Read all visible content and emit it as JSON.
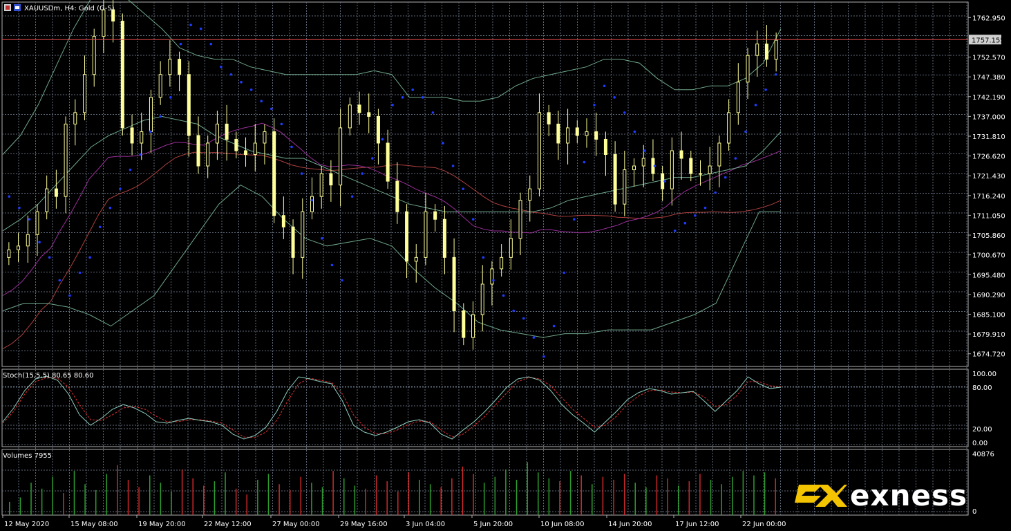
{
  "header": {
    "symbol_title": "XAUUSDm, H4:  Gold (G-S)"
  },
  "indicators": {
    "stoch_label": "Stoch(15,5,5) 80.65 80.60",
    "volumes_label": "Volumes 7955"
  },
  "branding": {
    "name": "exness",
    "logo_color": "#f5c400"
  },
  "colors": {
    "background": "#000000",
    "grid": "#5f6a7a",
    "frame": "#b0b0b0",
    "candle": "#ffff99",
    "bollinger": "#6fa88c",
    "ma_fast": "#9b2f9b",
    "ma_slow": "#b04040",
    "psar": "#1f3cff",
    "current_price_line": "#e04a4a",
    "stoch_main": "#8fcfc0",
    "stoch_signal": "#e03030",
    "volume_up": "#2e9e2e",
    "volume_down": "#d02a2a"
  },
  "chart_data": [
    {
      "type": "candlestick",
      "title": "XAUUSDm, H4:  Gold (G-S)",
      "y_ticks": [
        "1762.950",
        "1757.155",
        "1752.570",
        "1747.380",
        "1742.190",
        "1737.000",
        "1731.810",
        "1726.620",
        "1721.430",
        "1716.240",
        "1711.050",
        "1705.860",
        "1700.670",
        "1695.480",
        "1690.290",
        "1685.100",
        "1679.910",
        "1674.720"
      ],
      "current_price": 1757.155,
      "ylim": [
        1671.4,
        1767.0
      ],
      "x_ticks": [
        "12 May 2020",
        "15 May 08:00",
        "19 May 20:00",
        "22 May 12:00",
        "27 May 00:00",
        "29 May 16:00",
        "3 Jun 04:00",
        "5 Jun 20:00",
        "10 Jun 08:00",
        "14 Jun 20:00",
        "17 Jun 12:00",
        "22 Jun 00:00"
      ],
      "close_series": [
        1702,
        1703,
        1706,
        1712,
        1718,
        1716,
        1735,
        1738,
        1748,
        1758,
        1765,
        1762,
        1734,
        1730,
        1733,
        1742,
        1748,
        1752,
        1748,
        1732,
        1724,
        1730,
        1735,
        1731,
        1728,
        1727,
        1730,
        1733,
        1711,
        1708,
        1700,
        1712,
        1716,
        1722,
        1719,
        1734,
        1740,
        1738,
        1737,
        1730,
        1720,
        1712,
        1699,
        1700,
        1712,
        1710,
        1700,
        1686,
        1679,
        1685,
        1693,
        1697,
        1700,
        1705,
        1715,
        1718,
        1738,
        1735,
        1730,
        1734,
        1732,
        1733,
        1731,
        1727,
        1714,
        1723,
        1724,
        1726,
        1722,
        1718,
        1728,
        1726,
        1722,
        1722,
        1724,
        1730,
        1738,
        1746,
        1753,
        1756,
        1752,
        1757
      ],
      "bollinger_upper_series": [
        1727,
        1732,
        1740,
        1750,
        1760,
        1768,
        1770,
        1768,
        1764,
        1760,
        1755,
        1753,
        1752,
        1752,
        1750,
        1749,
        1748,
        1748,
        1748,
        1748,
        1748,
        1749,
        1748,
        1742,
        1742,
        1742,
        1741,
        1741,
        1742,
        1745,
        1747,
        1748,
        1749,
        1750,
        1752,
        1752,
        1751,
        1747,
        1744,
        1744,
        1745,
        1745,
        1747,
        1751,
        1760
      ],
      "bollinger_mid_series": [
        1707,
        1710,
        1714,
        1719,
        1724,
        1729,
        1732,
        1734,
        1736,
        1737,
        1736,
        1735,
        1732,
        1730,
        1728,
        1727,
        1726,
        1726,
        1724,
        1722,
        1720,
        1718,
        1716,
        1714,
        1713,
        1712,
        1712,
        1712,
        1712,
        1712,
        1712,
        1713,
        1715,
        1716,
        1717,
        1718,
        1719,
        1720,
        1721,
        1721,
        1722,
        1723,
        1724,
        1728,
        1733
      ],
      "bollinger_lower_series": [
        1686,
        1688,
        1688,
        1687,
        1685,
        1682,
        1686,
        1690,
        1698,
        1706,
        1714,
        1719,
        1716,
        1710,
        1705,
        1703,
        1704,
        1705,
        1703,
        1697,
        1692,
        1688,
        1683,
        1681,
        1680,
        1679,
        1680,
        1680,
        1681,
        1681,
        1681,
        1683,
        1685,
        1688,
        1700,
        1712,
        1712
      ],
      "psar_series": [
        1716,
        1713,
        1710,
        1704,
        1700,
        1694,
        1690,
        1696,
        1700,
        1708,
        1713,
        1718,
        1723,
        1727,
        1733,
        1737,
        1742,
        1756,
        1761,
        1760,
        1756,
        1750,
        1748,
        1746,
        1744,
        1741,
        1739,
        1735,
        1729,
        1722,
        1715,
        1705,
        1698,
        1694,
        1716,
        1722,
        1726,
        1731,
        1740,
        1742,
        1744,
        1742,
        1738,
        1730,
        1724,
        1718,
        1710,
        1700,
        1694,
        1690,
        1686,
        1684,
        1679,
        1674,
        1682,
        1696,
        1710,
        1725,
        1740,
        1745,
        1742,
        1738,
        1733,
        1728,
        1724,
        1720,
        1707,
        1709,
        1711,
        1713,
        1717,
        1721,
        1726,
        1733,
        1740,
        1744,
        1748
      ]
    },
    {
      "type": "line",
      "name": "Stoch(15,5,5) 80.65 80.60",
      "y_ticks": [
        "100.00",
        "80.00",
        "20.00",
        "0.00"
      ],
      "ylim": [
        0,
        100
      ],
      "main": [
        30,
        50,
        75,
        92,
        96,
        90,
        70,
        40,
        25,
        35,
        48,
        55,
        50,
        42,
        30,
        28,
        32,
        35,
        32,
        30,
        25,
        12,
        5,
        10,
        22,
        45,
        75,
        95,
        92,
        88,
        85,
        60,
        25,
        15,
        10,
        15,
        22,
        30,
        33,
        28,
        12,
        5,
        18,
        30,
        45,
        62,
        80,
        92,
        95,
        90,
        75,
        55,
        40,
        28,
        15,
        30,
        45,
        62,
        72,
        78,
        75,
        70,
        72,
        74,
        60,
        45,
        60,
        75,
        95,
        85,
        78,
        80
      ],
      "signal": [
        28,
        45,
        70,
        88,
        94,
        93,
        80,
        55,
        33,
        32,
        40,
        50,
        52,
        48,
        38,
        30,
        30,
        33,
        33,
        31,
        28,
        18,
        8,
        7,
        15,
        32,
        60,
        85,
        93,
        90,
        87,
        70,
        40,
        22,
        13,
        13,
        18,
        26,
        31,
        30,
        18,
        8,
        12,
        24,
        38,
        55,
        72,
        88,
        94,
        92,
        82,
        65,
        48,
        35,
        22,
        25,
        38,
        55,
        67,
        75,
        76,
        73,
        72,
        73,
        66,
        52,
        55,
        68,
        88,
        88,
        82,
        81
      ]
    },
    {
      "type": "bar",
      "name": "Volumes 7955",
      "y_ticks": [
        "40876",
        "0"
      ],
      "ylim": [
        0,
        40876
      ],
      "values": [
        9000,
        12000,
        22000,
        18000,
        26000,
        15000,
        30000,
        21000,
        17000,
        28000,
        34000,
        24000,
        19000,
        27000,
        22000,
        16000,
        31000,
        25000,
        20000,
        23000,
        29000,
        18000,
        14000,
        24000,
        28000,
        21000,
        17000,
        26000,
        22000,
        19000,
        30000,
        25000,
        20000,
        18000,
        27000,
        23000,
        16000,
        29000,
        24000,
        21000,
        19000,
        25000,
        33000,
        28000,
        22000,
        26000,
        31000,
        24000,
        36000,
        29000,
        25000,
        23000,
        30000,
        27000,
        21000,
        26000,
        24000,
        28000,
        22000,
        19000,
        27000,
        25000,
        20000,
        23000,
        28000,
        24000,
        21000,
        26000,
        30000,
        27000,
        29000,
        25000
      ]
    }
  ]
}
